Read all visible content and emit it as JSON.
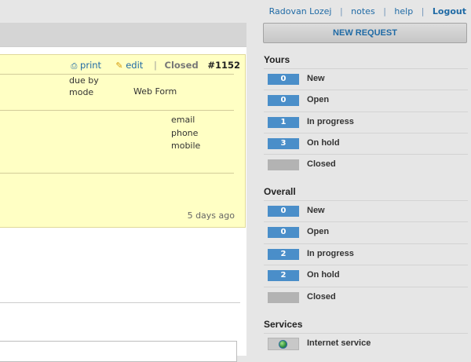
{
  "topnav": {
    "user": "Radovan Lozej",
    "notes": "notes",
    "help": "help",
    "logout": "Logout",
    "sep": "|"
  },
  "ticket": {
    "print": "print",
    "edit": "edit",
    "sep": "|",
    "status": "Closed",
    "number": "#1152",
    "due_by_label": "due by",
    "mode_label": "mode",
    "mode_value": "Web Form",
    "email_label": "email",
    "phone_label": "phone",
    "mobile_label": "mobile",
    "timestamp": "5 days ago"
  },
  "sidebar": {
    "new_request": "NEW REQUEST",
    "yours": {
      "title": "Yours",
      "items": [
        {
          "count": "0",
          "label": "New"
        },
        {
          "count": "0",
          "label": "Open"
        },
        {
          "count": "1",
          "label": "In progress"
        },
        {
          "count": "3",
          "label": "On hold"
        },
        {
          "count": "",
          "label": "Closed"
        }
      ]
    },
    "overall": {
      "title": "Overall",
      "items": [
        {
          "count": "0",
          "label": "New"
        },
        {
          "count": "0",
          "label": "Open"
        },
        {
          "count": "2",
          "label": "In progress"
        },
        {
          "count": "2",
          "label": "On hold"
        },
        {
          "count": "",
          "label": "Closed"
        }
      ]
    },
    "services": {
      "title": "Services",
      "items": [
        {
          "label": "Internet service",
          "icon": "globe-icon"
        }
      ]
    }
  },
  "colors": {
    "accent": "#1f6aa5",
    "badge": "#4a8ec9",
    "badge_empty": "#b3b3b3",
    "ticket_bg": "#ffffc4"
  }
}
